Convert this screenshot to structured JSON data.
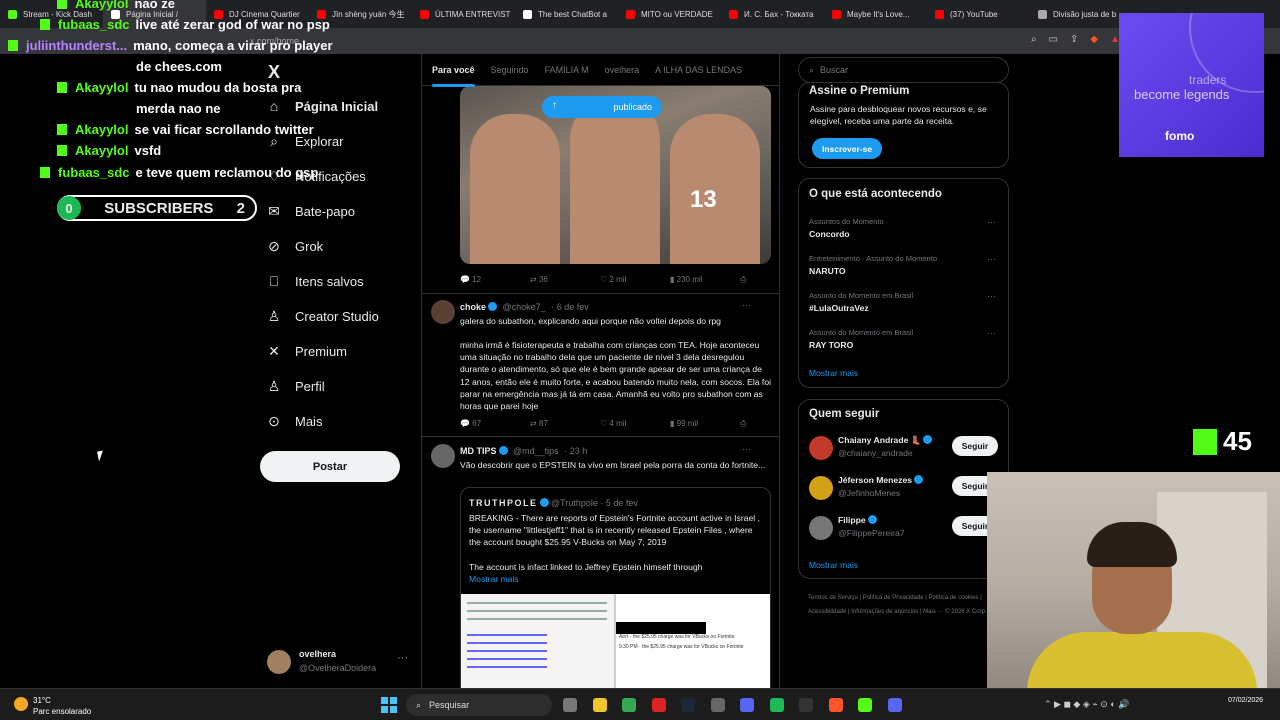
{
  "browser": {
    "tabs": [
      {
        "label": "Stream - Kick Dash",
        "color": "#53fc18"
      },
      {
        "label": "Página Inicial /",
        "color": "#ffffff",
        "active": true
      },
      {
        "label": "DJ Cinema Quartier",
        "color": "#ff0000"
      },
      {
        "label": "Jīn shèng yuán 今生",
        "color": "#ff0000"
      },
      {
        "label": "ÚLTIMA ENTREVIST",
        "color": "#ff0000"
      },
      {
        "label": "The best ChatBot a",
        "color": "#ffffff"
      },
      {
        "label": "MITO ou VERDADE",
        "color": "#ff0000"
      },
      {
        "label": "И. С. Бах - Токката",
        "color": "#ff0000"
      },
      {
        "label": "Maybe It's Love...",
        "color": "#ff0000"
      },
      {
        "label": "(37) YouTube",
        "color": "#ff0000"
      },
      {
        "label": "Divisão justa de b",
        "color": "#aaaaaa"
      }
    ],
    "url": "x.com/home"
  },
  "chat": {
    "lines": [
      {
        "user": "Akayylol",
        "msg": "nao ze"
      },
      {
        "user": "fubaas_sdc",
        "msg": "live até zerar god of war no psp"
      },
      {
        "user": "juliinthunderst...",
        "msg": "mano, começa a virar pro player"
      },
      {
        "user": "",
        "msg": "de chees.com"
      },
      {
        "user": "Akayylol",
        "msg": "tu nao mudou da bosta pra"
      },
      {
        "user": "",
        "msg": "merda nao ne"
      },
      {
        "user": "Akayylol",
        "msg": "se vai ficar scrollando twitter"
      },
      {
        "user": "Akayylol",
        "msg": "vsfd"
      },
      {
        "user": "fubaas_sdc",
        "msg": "e teve quem reclamou do gsp"
      }
    ],
    "subscribers": {
      "left": "0",
      "label": "SUBSCRIBERS",
      "right": "2"
    }
  },
  "nav": {
    "logo": "X",
    "items": [
      {
        "label": "Página Inicial",
        "icon": "home-icon"
      },
      {
        "label": "Explorar",
        "icon": "search-icon"
      },
      {
        "label": "Notificações",
        "icon": "bell-icon"
      },
      {
        "label": "Bate-papo",
        "icon": "envelope-icon"
      },
      {
        "label": "Grok",
        "icon": "grok-icon"
      },
      {
        "label": "Itens salvos",
        "icon": "bookmark-icon"
      },
      {
        "label": "Creator Studio",
        "icon": "creator-icon"
      },
      {
        "label": "Premium",
        "icon": "x-icon"
      },
      {
        "label": "Perfil",
        "icon": "person-icon"
      },
      {
        "label": "Mais",
        "icon": "more-icon"
      }
    ],
    "post_label": "Postar",
    "account": {
      "name": "ovelhera",
      "handle": "@OvelheraDoidera"
    }
  },
  "feed": {
    "tabs": [
      "Para você",
      "Seguindo",
      "FAMÍLIA M",
      "ovelhera",
      "A ILHA DAS LENDAS"
    ],
    "published_pill": "publicado",
    "photo_number": "13",
    "post1_actions": {
      "replies": "12",
      "reposts": "36",
      "likes": "2 mil",
      "views": "230 mil"
    },
    "post2": {
      "name": "choke",
      "handle": "@choke7_",
      "time": "· 6 de fev",
      "text1": "galera do subathon, explicando aqui porque não voltei depois do rpg",
      "text2": "minha irmã é fisioterapeuta e trabalha com crianças com TEA. Hoje aconteceu uma situação no trabalho dela que um paciente de nível 3 dela desregulou durante o atendimento, só que ele é bem grande apesar de ser uma criança de 12 anos, então ele é muito forte,  e acabou batendo muito nela, com socos. Ela foi parar na emergência mas já tá em casa. Amanhã eu volto pro subathon com as horas que parei hoje",
      "actions": {
        "replies": "67",
        "reposts": "87",
        "likes": "4 mil",
        "views": "99 mil"
      }
    },
    "post3": {
      "name": "MD TIPS",
      "handle": "@md__tips",
      "time": "· 23 h",
      "text": "Vão descobrir que o EPSTEIN ta vivo em Israel pela porra da conta do fortnite...",
      "quote": {
        "name": "TRUTHPOLE",
        "handle": "@Truthpole",
        "time": "· 5 de fev",
        "text1": "BREAKING - There are reports of Epstein's Fortnite account active in Israel , the username \"littlestjeff1\" that is in recently released Epstein Files , where the account bought $25.95 V-Bucks on May 7, 2019",
        "text2": "The account is infact linked to Jeffrey Epstein himself through",
        "more": "Mostrar mais",
        "doc_line1": "Ain't - the $25.95 charge was for VBucks on Fortnite",
        "doc_line2": "9:30 PM · the $25.95 charge was for VBucks on Fortnite"
      }
    }
  },
  "right": {
    "search_placeholder": "Buscar",
    "premium": {
      "title": "Assine o Premium",
      "text": "Assine para desbloquear novos recursos e, se elegível, receba uma parte da receita.",
      "button": "Inscrever-se"
    },
    "trends_title": "O que está acontecendo",
    "trends": [
      {
        "context": "Assuntos do Momento",
        "name": "Concordo"
      },
      {
        "context": "Entretenimento · Assunto do Momento",
        "name": "NARUTO"
      },
      {
        "context": "Assunto do Momento em Brasil",
        "name": "#LulaOutraVez"
      },
      {
        "context": "Assunto do Momento em Brasil",
        "name": "RAY TORO"
      }
    ],
    "show_more": "Mostrar mais",
    "who_title": "Quem seguir",
    "who": [
      {
        "name": "Chaiany Andrade 👢",
        "handle": "@chaiany_andrade",
        "color": "#c0392b"
      },
      {
        "name": "Jéferson Menezes",
        "handle": "@JefinhoMenes",
        "color": "#d4a017"
      },
      {
        "name": "Filippe",
        "handle": "@FilippePereira7",
        "color": "#777777"
      }
    ],
    "follow_label": "Seguir",
    "footer": "Termos de Serviço  |  Política de Privacidade  |  Política de cookies  |  Acessibilidade  |  Informações de anúncios  |  Mais ···  © 2026 X Corp."
  },
  "overlay": {
    "ad": {
      "t1": "traders",
      "t2": "become legends",
      "t3": "fomo"
    },
    "kick_count": "45"
  },
  "taskbar": {
    "temp": "31°C",
    "weather": "Parc ensolarado",
    "search": "Pesquisar",
    "date": "07/02/2026"
  }
}
